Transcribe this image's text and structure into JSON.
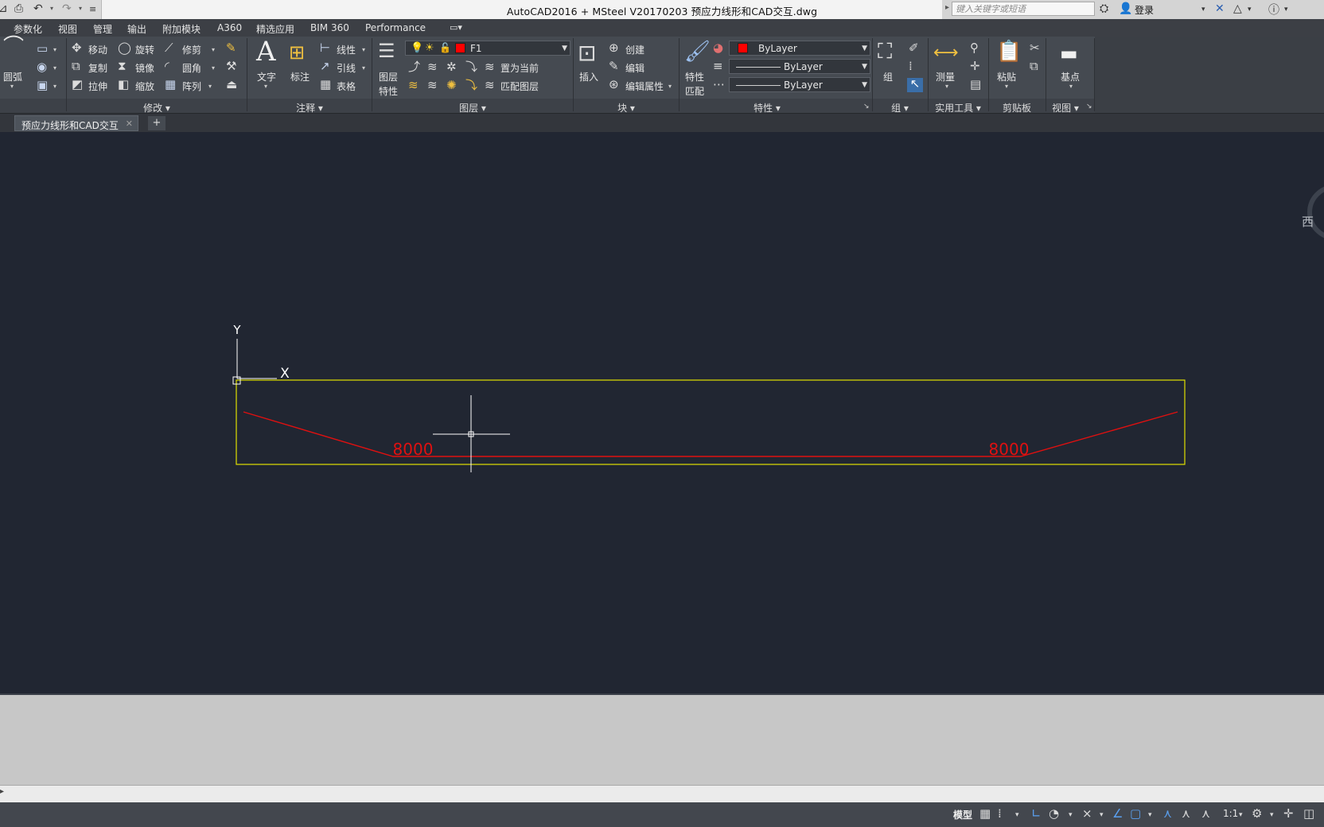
{
  "window": {
    "title": "AutoCAD2016 + MSteel V20170203    预应力线形和CAD交互.dwg",
    "search_placeholder": "键入关键字或短语",
    "login_label": "登录"
  },
  "menu_tabs": [
    "参数化",
    "视图",
    "管理",
    "输出",
    "附加模块",
    "A360",
    "精选应用",
    "BIM 360",
    "Performance"
  ],
  "ribbon": {
    "arc_label": "圆弧",
    "modify": {
      "title": "修改",
      "move": "移动",
      "rotate": "旋转",
      "trim": "修剪",
      "copy": "复制",
      "mirror": "镜像",
      "fillet": "圆角",
      "stretch": "拉伸",
      "scale": "缩放",
      "array": "阵列"
    },
    "annotation": {
      "title": "注释",
      "text": "文字",
      "dimension": "标注",
      "linear": "线性",
      "leader": "引线",
      "table": "表格"
    },
    "layers": {
      "title": "图层",
      "layer_props_1": "图层",
      "layer_props_2": "特性",
      "current_layer": "F1",
      "set_current": "置为当前",
      "match_layer": "匹配图层"
    },
    "block": {
      "title": "块",
      "insert": "插入",
      "create": "创建",
      "edit": "编辑",
      "edit_attr": "编辑属性"
    },
    "properties": {
      "title": "特性",
      "match_1": "特性",
      "match_2": "匹配",
      "color": "ByLayer",
      "linetype": "ByLayer",
      "lineweight": "ByLayer"
    },
    "group": {
      "title": "组",
      "group": "组"
    },
    "utilities": {
      "title": "实用工具",
      "measure": "测量"
    },
    "clipboard": {
      "title": "剪贴板",
      "paste": "粘贴"
    },
    "view": {
      "title": "视图",
      "base": "基点"
    }
  },
  "doc_tabs": [
    "预应力线形和CAD交互"
  ],
  "drawing": {
    "ucs_x": "X",
    "ucs_y": "Y",
    "dim_left": "8000",
    "dim_right": "8000",
    "viewcube": "西"
  },
  "status": {
    "model": "模型",
    "scale": "1:1"
  },
  "colors": {
    "canvas_bg": "#212632",
    "boundary": "#e0e000",
    "tendon": "#e01010",
    "ribbon_bg": "#454a51"
  }
}
